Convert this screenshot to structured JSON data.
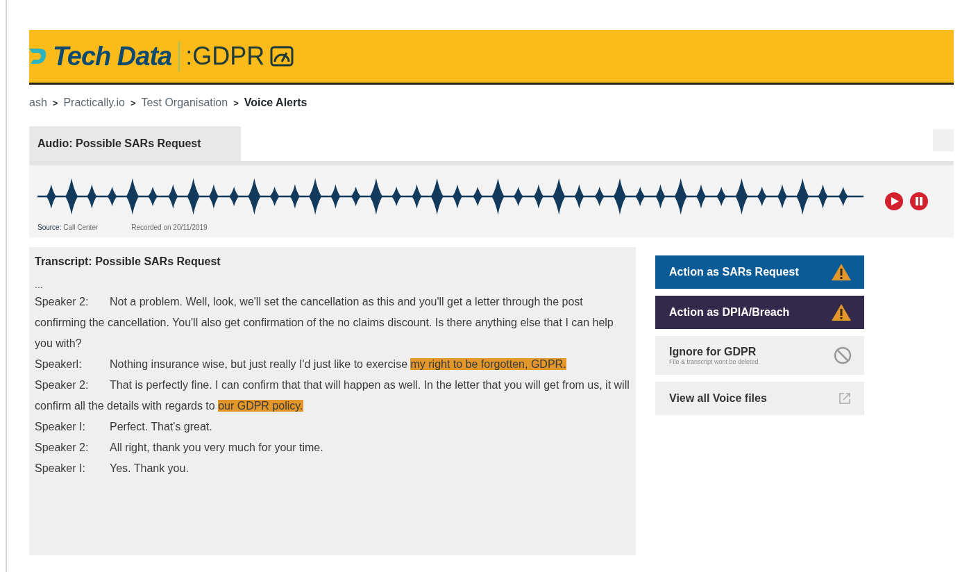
{
  "header": {
    "brand": "Tech Data",
    "product": ":GDPR"
  },
  "breadcrumb": [
    {
      "label": "ash",
      "current": false
    },
    {
      "label": "Practically.io",
      "current": false
    },
    {
      "label": "Test Organisation",
      "current": false
    },
    {
      "label": "Voice Alerts",
      "current": true
    }
  ],
  "breadcrumb_separator": ">",
  "tabs": [
    {
      "label": "Audio: Possible SARs Request",
      "selected": true
    }
  ],
  "audio": {
    "source_label": "Source:",
    "source": "Call Center",
    "recorded": "Recorded on 20/11/2019"
  },
  "transcript": {
    "title": "Transcript: Possible SARs Request",
    "ellipsis": "...",
    "lines": [
      {
        "speaker": "Speaker 2:",
        "segments": [
          {
            "text": "Not a problem. Well, look, we'll set the cancellation as this and you'll get a letter through the post confirming the cancellation. You'll also get confirmation of the no claims discount. Is there anything else that I can help you with?",
            "highlighted": false
          }
        ]
      },
      {
        "speaker": "Speakerl:",
        "segments": [
          {
            "text": "Nothing insurance wise, but just really I'd just like to exercise ",
            "highlighted": false
          },
          {
            "text": "my right to be forgotten, GDPR.",
            "highlighted": true
          }
        ]
      },
      {
        "speaker": "Speaker 2:",
        "segments": [
          {
            "text": "That is perfectly fine. I can confirm that that will happen as well. In the letter that you will get from us, it will confirm all the details with regards to ",
            "highlighted": false
          },
          {
            "text": "our GDPR policy.",
            "highlighted": true
          }
        ]
      },
      {
        "speaker": "Speaker I:",
        "segments": [
          {
            "text": "Perfect. That's great.",
            "highlighted": false
          }
        ]
      },
      {
        "speaker": "Speaker 2:",
        "segments": [
          {
            "text": "All right, thank you very much for your time.",
            "highlighted": false
          }
        ]
      },
      {
        "speaker": "Speaker I:",
        "segments": [
          {
            "text": "Yes. Thank you.",
            "highlighted": false
          }
        ]
      }
    ]
  },
  "actions": [
    {
      "kind": "sars",
      "label": "Action as SARs Request"
    },
    {
      "kind": "dpia",
      "label": "Action as DPIA/Breach"
    },
    {
      "kind": "ignore",
      "label": "Ignore for GDPR",
      "note": "File & transcript wont be deleted"
    },
    {
      "kind": "view",
      "label": "View all Voice files"
    }
  ]
}
